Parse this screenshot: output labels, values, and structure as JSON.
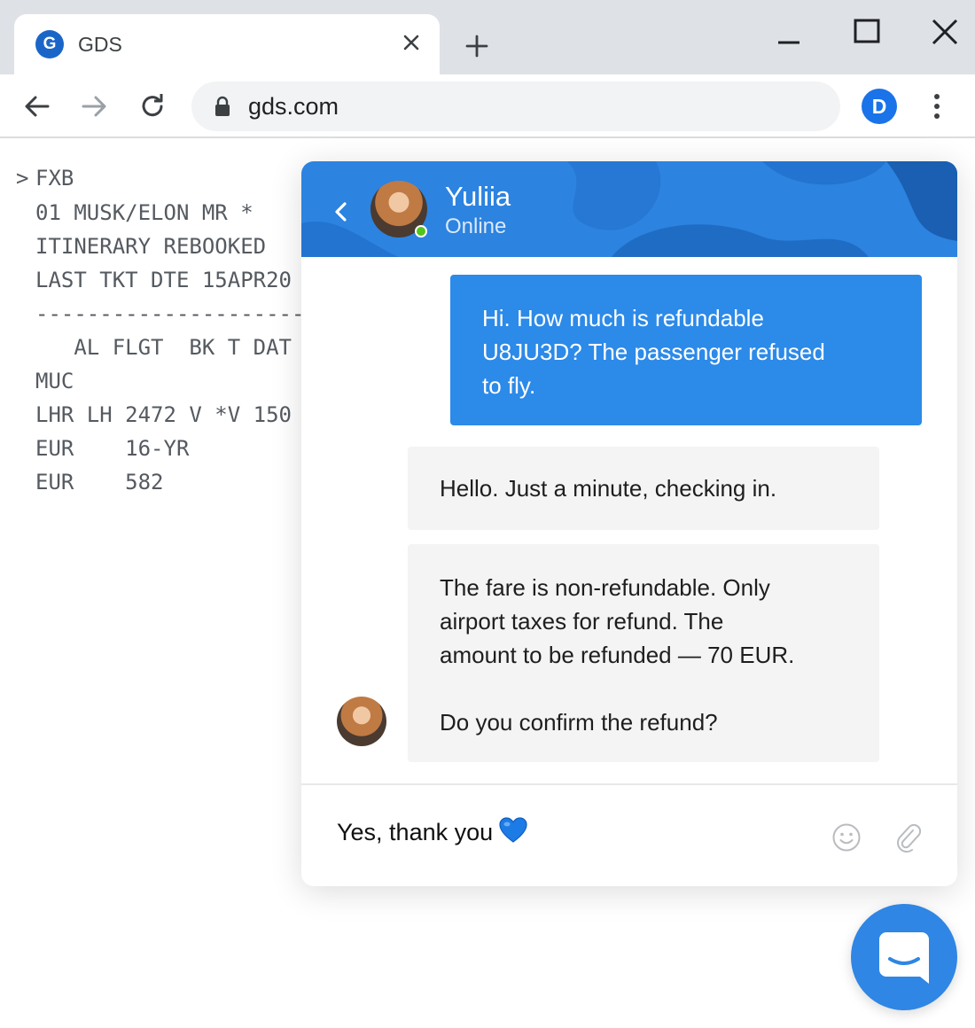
{
  "browser": {
    "tab": {
      "favicon_letter": "G",
      "title": "GDS"
    },
    "address_bar": {
      "url": "gds.com"
    },
    "profile_letter": "D"
  },
  "terminal": {
    "prompt": ">",
    "lines": [
      "FXB",
      "01 MUSK/ELON MR *",
      "ITINERARY REBOOKED",
      "LAST TKT DTE 15APR20",
      "-----------------------",
      "   AL FLGT  BK T DAT",
      "MUC",
      "LHR LH 2472 V *V 150",
      "EUR    16-YR",
      "EUR    582"
    ]
  },
  "chat": {
    "agent": {
      "name": "Yuliia",
      "status": "Online"
    },
    "messages": [
      {
        "direction": "outgoing",
        "lines": [
          "Hi. How much is refundable",
          "U8JU3D? The passenger refused",
          "to fly."
        ]
      },
      {
        "direction": "incoming",
        "lines": [
          "Hello. Just a minute, checking in."
        ]
      },
      {
        "direction": "incoming",
        "paragraph_1": [
          "The fare is non-refundable. Only",
          "airport taxes for refund. The",
          "amount to be refunded — 70 EUR."
        ],
        "paragraph_2": "Do you confirm the refund?"
      }
    ],
    "composer": {
      "value": "Yes, thank you"
    }
  },
  "colors": {
    "header_blue": "#2c83e0",
    "outgoing_bubble": "#2c8ae8",
    "incoming_bubble": "#f4f4f5",
    "online_green": "#52c41a",
    "launcher_blue": "#2f86e4"
  },
  "icons": {
    "tab_close": "close-icon",
    "new_tab": "plus-icon",
    "back": "arrow-left-icon",
    "forward": "arrow-right-icon",
    "reload": "reload-icon",
    "lock": "lock-icon",
    "menu": "more-vertical-icon",
    "chat_back": "chevron-left-icon",
    "emoji": "smiley-icon",
    "attach": "paperclip-icon",
    "heart": "blue-heart-icon",
    "launcher": "chat-bubble-icon"
  }
}
